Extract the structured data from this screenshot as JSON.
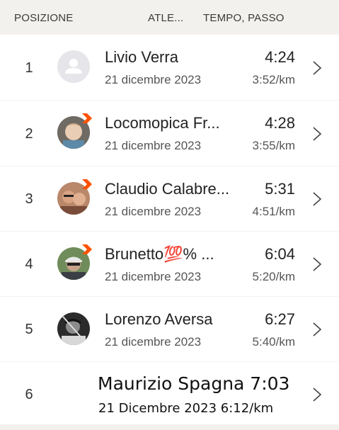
{
  "header": {
    "position_label": "POSIZIONE",
    "athlete_label": "ATLE...",
    "time_label": "TEMPO, PASSO"
  },
  "rows": [
    {
      "position": "1",
      "name": "Livio Verra",
      "time": "4:24",
      "date": "21 dicembre 2023",
      "pace": "3:52/km",
      "avatar": "default-person-icon",
      "badge": false
    },
    {
      "position": "2",
      "name": "Locomopica Fr...",
      "time": "4:28",
      "date": "21 dicembre 2023",
      "pace": "3:55/km",
      "avatar": "photo",
      "badge": true
    },
    {
      "position": "3",
      "name": "Claudio Calabre...",
      "time": "5:31",
      "date": "21 dicembre 2023",
      "pace": "4:51/km",
      "avatar": "photo",
      "badge": true
    },
    {
      "position": "4",
      "name": "Brunetto💯% ...",
      "time": "6:04",
      "date": "21 dicembre 2023",
      "pace": "5:20/km",
      "avatar": "photo",
      "badge": true
    },
    {
      "position": "5",
      "name": "Lorenzo Aversa",
      "time": "6:27",
      "date": "21 dicembre 2023",
      "pace": "5:40/km",
      "avatar": "photo",
      "badge": false
    },
    {
      "position": "6",
      "name_time": "Maurizio Spagna 7:03",
      "date_pace": "21 Dicembre 2023 6:12/km"
    }
  ],
  "colors": {
    "header_bg": "#f3f1ee",
    "row_bg": "#ffffff",
    "badge": "#fc5200",
    "divider": "#e4e2df"
  }
}
